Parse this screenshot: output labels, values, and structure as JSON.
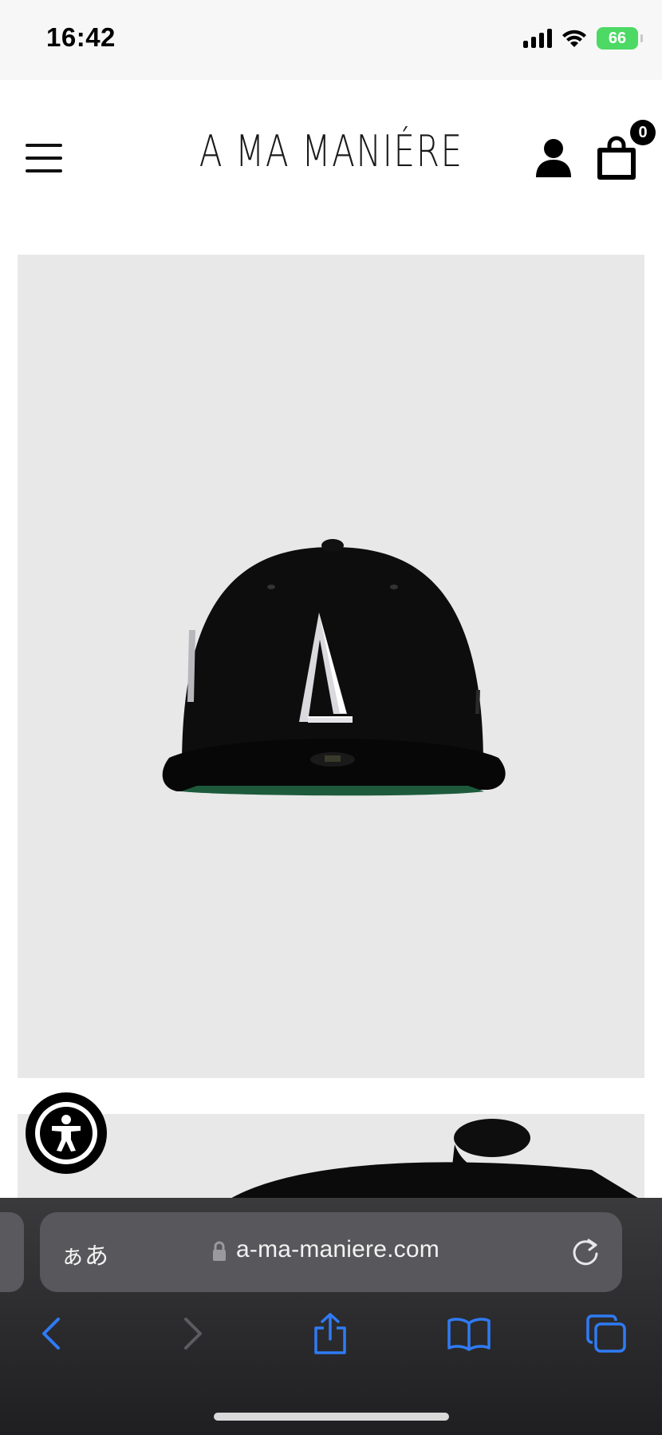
{
  "status_bar": {
    "time": "16:42",
    "battery": "66"
  },
  "header": {
    "brand": "A MA MANIÉRE",
    "cart_count": "0"
  },
  "browser": {
    "aa_label": "ぁあ",
    "url": "a-ma-maniere.com"
  },
  "icons": {
    "menu": "hamburger-menu-icon",
    "account": "user-icon",
    "cart": "shopping-bag-icon",
    "accessibility": "accessibility-icon",
    "back": "chevron-left-icon",
    "forward": "chevron-right-icon",
    "share": "share-icon",
    "bookmarks": "book-icon",
    "tabs": "tabs-icon",
    "reload": "reload-icon",
    "lock": "lock-icon"
  },
  "colors": {
    "accent": "#2f7bf5",
    "battery": "#4cd964",
    "image_bg": "#e8e8e8"
  }
}
